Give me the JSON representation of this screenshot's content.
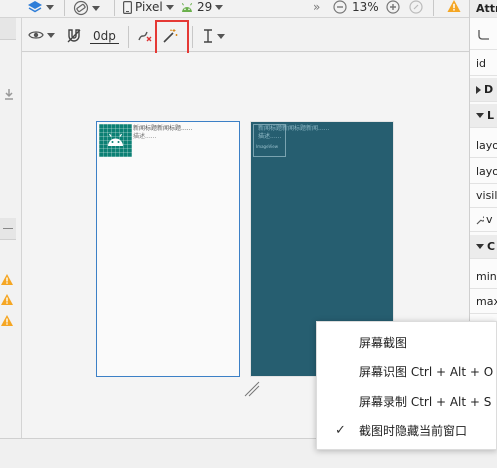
{
  "toolbar": {
    "device_label": "Pixel",
    "api_level": "29",
    "zoom_level": "13%",
    "overflow_label": "»",
    "margin_value": "0dp"
  },
  "attributes_panel": {
    "title": "Attri",
    "rows": [
      "id",
      "D",
      "L",
      "layo",
      "layo",
      "visil",
      "v",
      "C",
      "min",
      "max"
    ]
  },
  "preview": {
    "light_title": "新闻标题新闻标题......",
    "light_subtitle": "描述......",
    "dark_title": "新闻标题新闻标题新闻......",
    "dark_subtitle": "描述......",
    "dark_thumb_label": "ImageView"
  },
  "context_menu": {
    "items": [
      {
        "label": "屏幕截图",
        "checked": false
      },
      {
        "label": "屏幕识图 Ctrl + Alt + O",
        "checked": false
      },
      {
        "label": "屏幕录制 Ctrl + Alt + S",
        "checked": false
      },
      {
        "label": "截图时隐藏当前窗口",
        "checked": true
      }
    ]
  },
  "colors": {
    "highlight_border": "#e53935",
    "dark_preview_bg": "#265e70",
    "thumb_bg": "#0c8074",
    "warning": "#f5a623",
    "selection_border": "#3c80c6"
  }
}
